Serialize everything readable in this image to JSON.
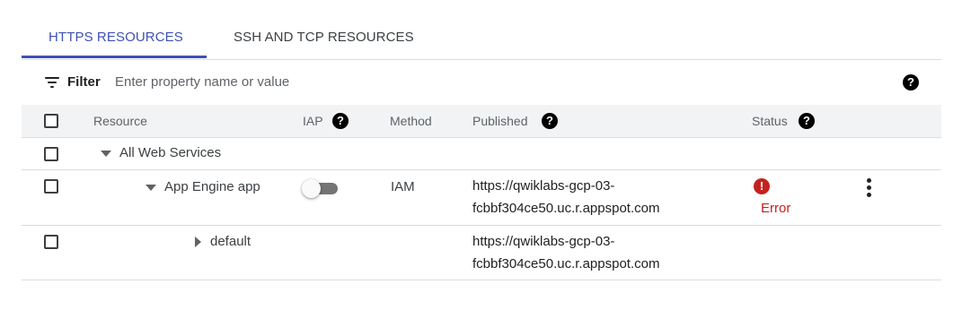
{
  "tabs": [
    {
      "label": "HTTPS RESOURCES",
      "active": true
    },
    {
      "label": "SSH AND TCP RESOURCES",
      "active": false
    }
  ],
  "filter": {
    "label": "Filter",
    "placeholder": "Enter property name or value",
    "help_glyph": "?"
  },
  "table": {
    "headers": {
      "resource": "Resource",
      "iap": "IAP",
      "method": "Method",
      "published": "Published",
      "status": "Status"
    },
    "help_glyph": "?",
    "rows": [
      {
        "resource": "All Web Services",
        "expanded": true
      },
      {
        "resource": "App Engine app",
        "expanded": true,
        "iap_enabled": false,
        "method": "IAM",
        "published_line1": "https://qwiklabs-gcp-03-",
        "published_line2": "fcbbf304ce50.uc.r.appspot.com",
        "status_icon": "!",
        "status": "Error"
      },
      {
        "resource": "default",
        "expanded": false,
        "published_line1": "https://qwiklabs-gcp-03-",
        "published_line2": "fcbbf304ce50.uc.r.appspot.com"
      }
    ]
  },
  "colors": {
    "accent": "#3f51b5",
    "error": "#c5221f",
    "header_bg": "#f1f3f4",
    "divider": "#dadce0"
  }
}
